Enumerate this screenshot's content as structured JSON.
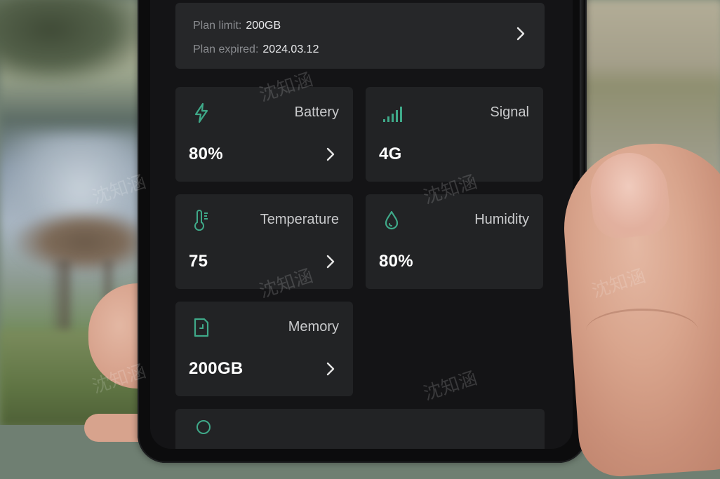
{
  "plan": {
    "limit_label": "Plan limit:",
    "limit_value": "200GB",
    "expired_label": "Plan expired:",
    "expired_value": "2024.03.12"
  },
  "tiles": {
    "battery": {
      "label": "Battery",
      "value": "80%",
      "icon": "lightning-bolt-icon"
    },
    "signal": {
      "label": "Signal",
      "value": "4G",
      "icon": "signal-bars-icon"
    },
    "temperature": {
      "label": "Temperature",
      "value": "75",
      "icon": "thermometer-icon"
    },
    "humidity": {
      "label": "Humidity",
      "value": "80%",
      "icon": "water-drop-icon"
    },
    "memory": {
      "label": "Memory",
      "value": "200GB",
      "icon": "sd-card-icon"
    }
  },
  "watermark": "沈知涵",
  "colors": {
    "accent": "#3fa989",
    "card_bg": "#222325",
    "plan_bg": "#262729",
    "screen_bg": "#141416"
  }
}
